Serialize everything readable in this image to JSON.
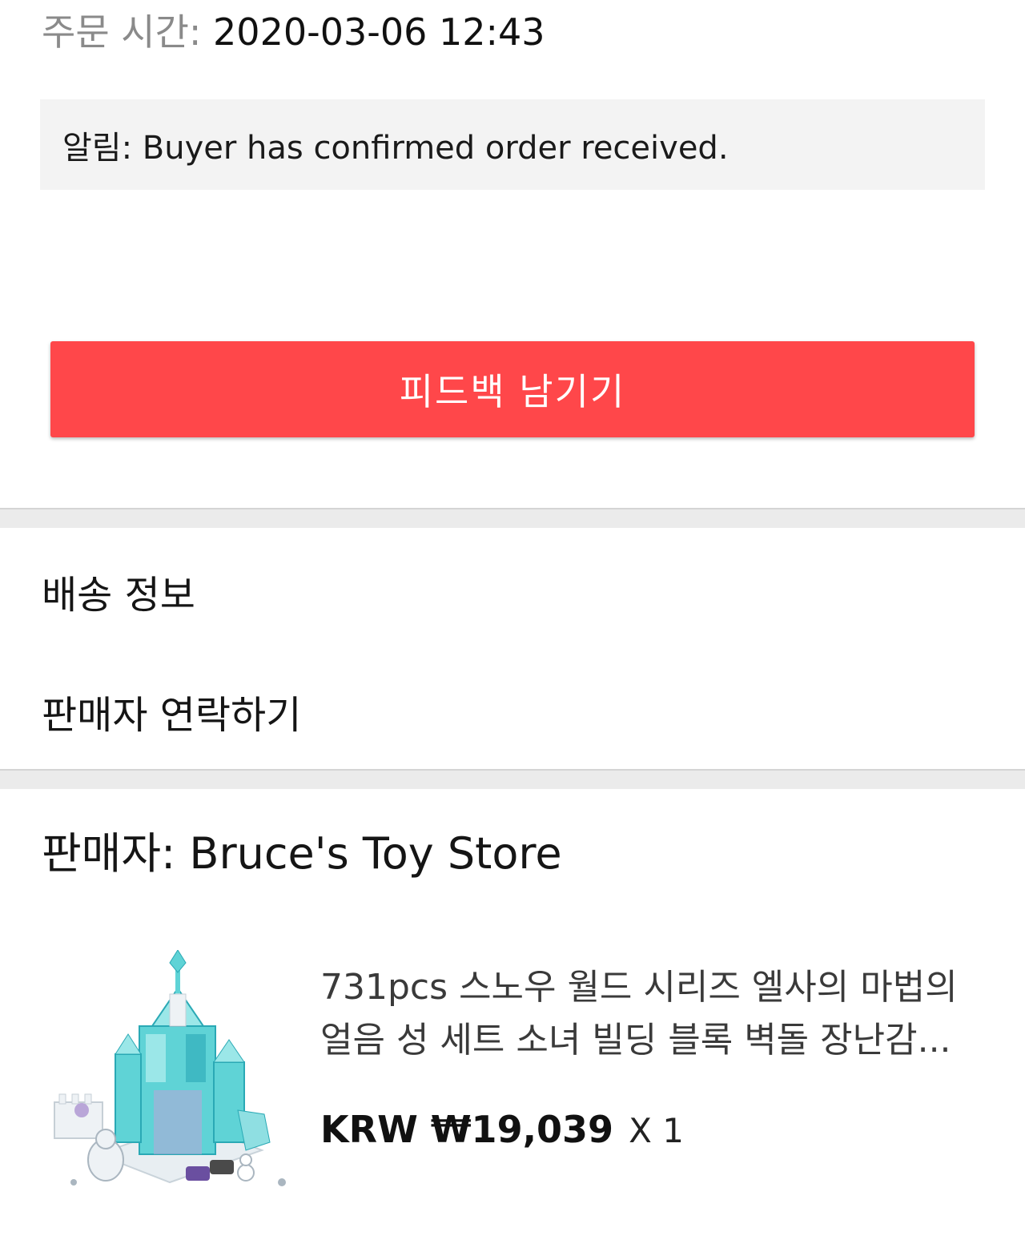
{
  "order": {
    "time_label": "주문 시간:",
    "time_value": "2020-03-06 12:43"
  },
  "notice": {
    "text": "알림: Buyer has confirmed order received."
  },
  "actions": {
    "feedback_label": "피드백 남기기"
  },
  "menu": {
    "shipping_info": "배송 정보",
    "contact_seller": "판매자 연락하기"
  },
  "seller": {
    "label": "판매자: Bruce's Toy Store"
  },
  "product": {
    "title_line1": "731pcs 스노우 월드 시리즈 엘사의 마법의",
    "title_line2": "얼음 성 세트 소녀 빌딩 블록 벽돌 장난감...",
    "price": "KRW ₩19,039",
    "quantity": "X 1",
    "image_colors": {
      "ice": "#5fd3d6",
      "ice_dark": "#2aa9b5",
      "white_brick": "#e8eef2",
      "purple": "#b9a6d8"
    }
  }
}
